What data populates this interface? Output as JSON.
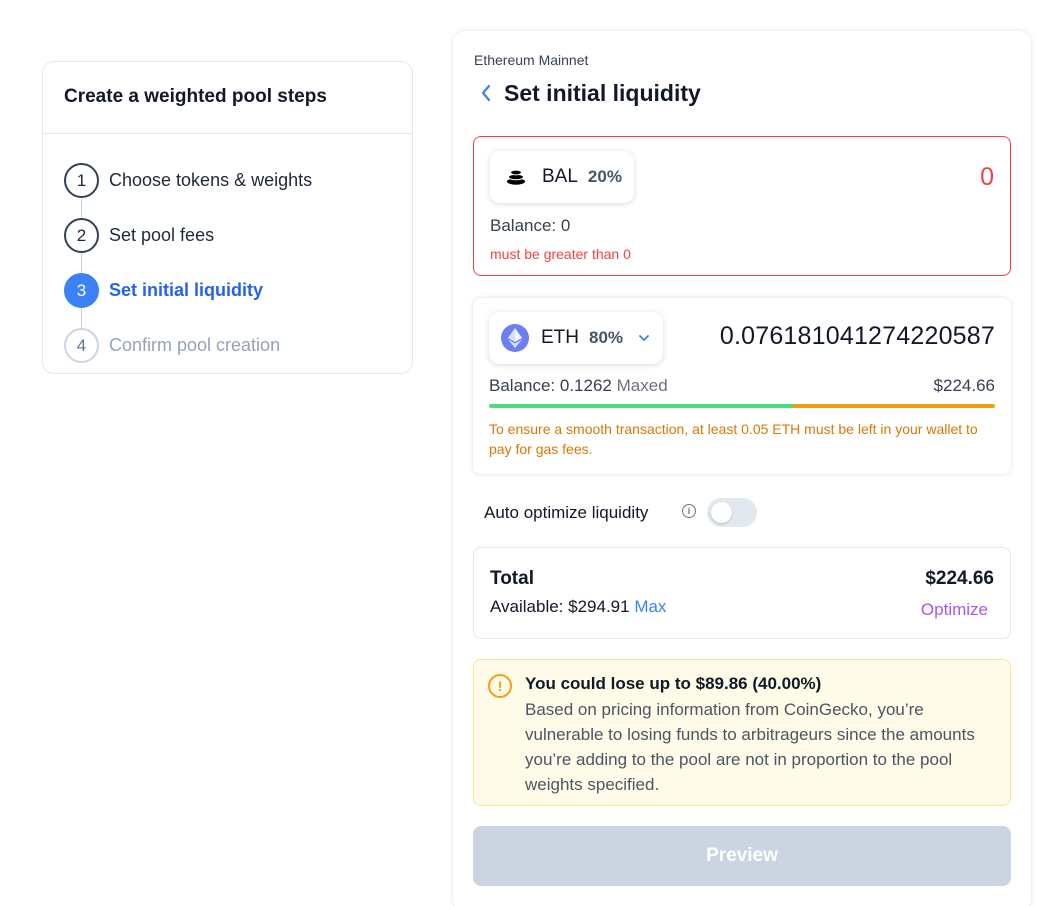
{
  "steps_card": {
    "title": "Create a weighted pool steps",
    "steps": [
      {
        "number": "1",
        "label": "Choose tokens & weights",
        "state": "complete"
      },
      {
        "number": "2",
        "label": "Set pool fees",
        "state": "complete"
      },
      {
        "number": "3",
        "label": "Set initial liquidity",
        "state": "active"
      },
      {
        "number": "4",
        "label": "Confirm pool creation",
        "state": "disabled"
      }
    ]
  },
  "panel": {
    "network": "Ethereum Mainnet",
    "title": "Set initial liquidity"
  },
  "tokens": [
    {
      "symbol": "BAL",
      "weight": "20%",
      "amount": "0",
      "balance_label": "Balance: 0",
      "error": "must be greater than 0",
      "icon": "bal-token-icon"
    },
    {
      "symbol": "ETH",
      "weight": "80%",
      "amount": "0.076181041274220587",
      "balance_label": "Balance: 0.1262",
      "maxed_label": "Maxed",
      "usd_value": "$224.66",
      "progress_fraction": 0.6,
      "gas_warning": "To ensure a smooth transaction, at least 0.05 ETH must be left in your wallet to pay for gas fees.",
      "icon": "eth-token-icon"
    }
  ],
  "auto_optimize": {
    "label": "Auto optimize liquidity",
    "info_glyph": "i",
    "enabled": false
  },
  "total": {
    "label": "Total",
    "value": "$224.66",
    "available_label": "Available: $294.91",
    "max_label": "Max",
    "optimize_label": "Optimize"
  },
  "warning": {
    "glyph": "!",
    "title": "You could lose up to $89.86 (40.00%)",
    "body": "Based on pricing information from CoinGecko, you’re vulnerable to losing funds to arbitrageurs since the amounts you’re adding to the pool are not in proportion to the pool weights specified."
  },
  "preview_button": {
    "label": "Preview"
  },
  "colors": {
    "accent": "#3b82f6",
    "error": "#ef4444",
    "warning_text": "#d97706",
    "progress_green": "#4ade80",
    "progress_orange": "#f59e0b",
    "optimize": "#a855f7"
  }
}
